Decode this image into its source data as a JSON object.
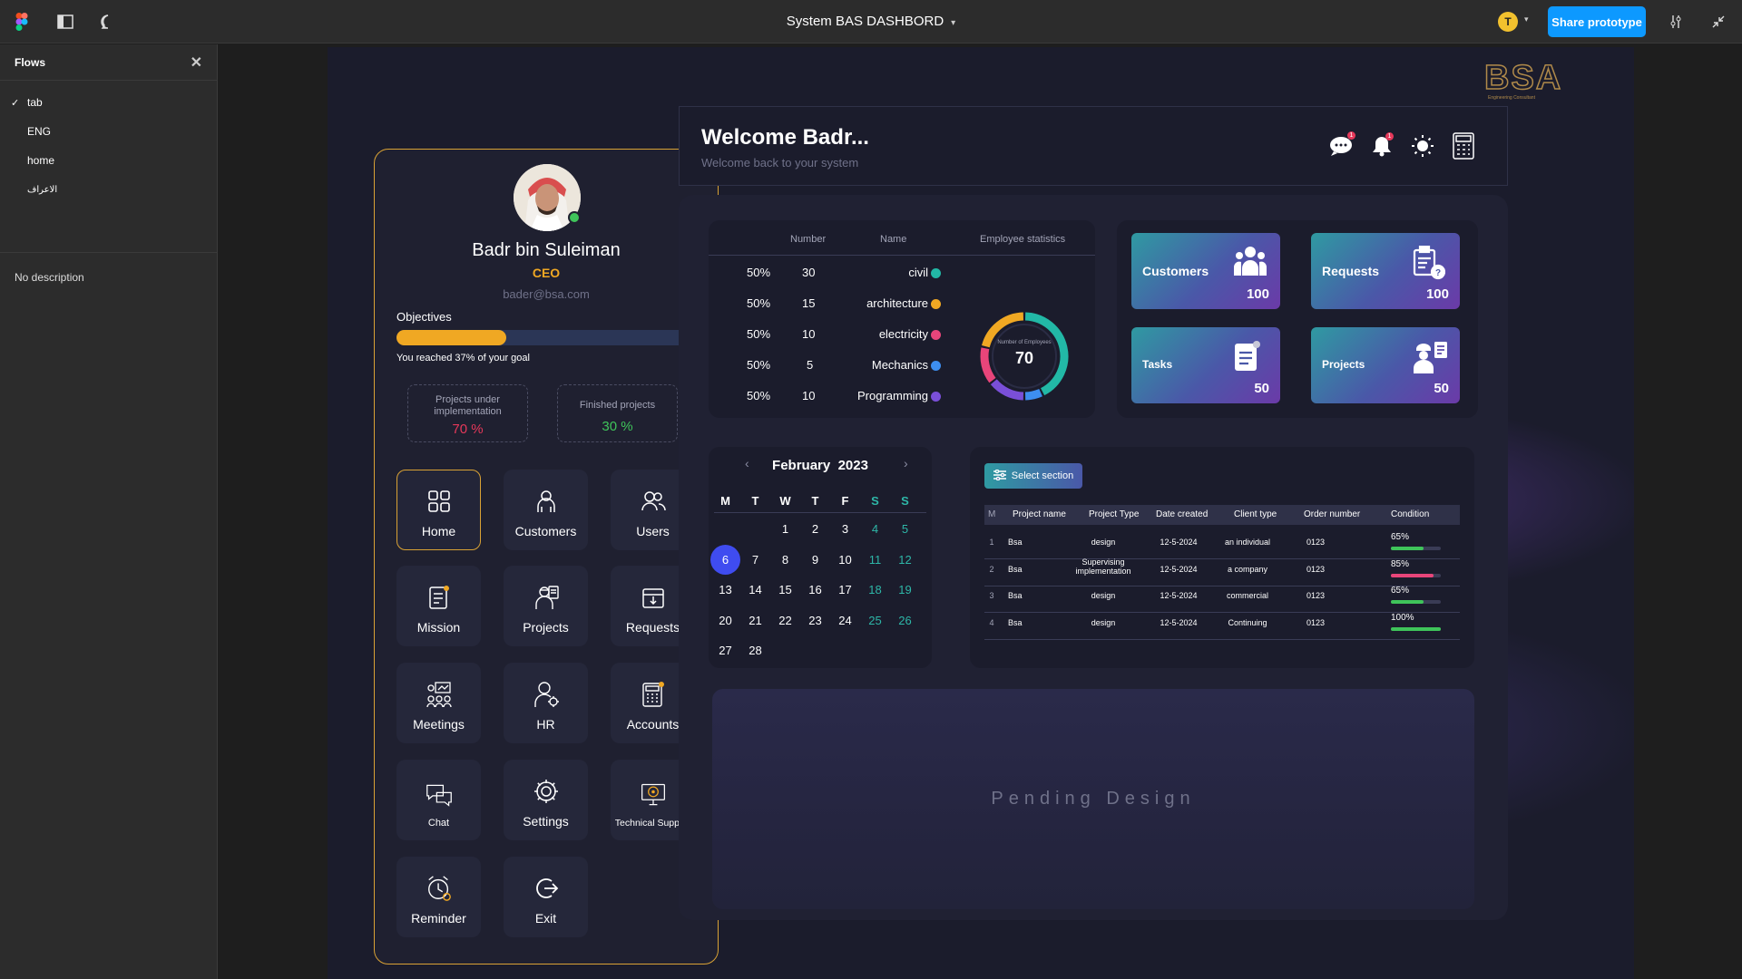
{
  "toolbar": {
    "title": "System BAS DASHBORD",
    "user_initial": "T",
    "share_label": "Share prototype"
  },
  "flows": {
    "header": "Flows",
    "items": [
      {
        "label": "tab",
        "checked": true
      },
      {
        "label": "ENG",
        "checked": false
      },
      {
        "label": "home",
        "checked": false
      },
      {
        "label": "الاعراف",
        "checked": false
      }
    ],
    "description": "No description"
  },
  "logo": {
    "text": "BSA",
    "tagline": "Engineering Consultant"
  },
  "profile": {
    "name": "Badr bin Suleiman",
    "role": "CEO",
    "email": "bader@bsa.com",
    "objectives_label": "Objectives",
    "objectives_progress": 0.37,
    "objectives_note": "You reached 37% of your goal",
    "stats": [
      {
        "label": "Projects under implementation",
        "value": "70 %",
        "color": "#e5385a"
      },
      {
        "label": "Finished projects",
        "value": "30 %",
        "color": "#3fc45a"
      }
    ]
  },
  "menu": [
    {
      "label": "Home",
      "icon": "grid-icon",
      "active": true
    },
    {
      "label": "Customers",
      "icon": "customers-icon",
      "active": false
    },
    {
      "label": "Users",
      "icon": "users-icon",
      "active": false
    },
    {
      "label": "Mission",
      "icon": "mission-icon",
      "active": false
    },
    {
      "label": "Projects",
      "icon": "projects-icon",
      "active": false
    },
    {
      "label": "Requests",
      "icon": "requests-icon",
      "active": false
    },
    {
      "label": "Meetings",
      "icon": "meetings-icon",
      "active": false
    },
    {
      "label": "HR",
      "icon": "hr-icon",
      "active": false
    },
    {
      "label": "Accounts",
      "icon": "calculator-icon",
      "active": false
    },
    {
      "label": "Chat",
      "icon": "chat-icon",
      "active": false
    },
    {
      "label": "Settings",
      "icon": "gear-icon",
      "active": false
    },
    {
      "label": "Technical Support",
      "icon": "support-icon",
      "active": false
    },
    {
      "label": "Reminder",
      "icon": "alarm-icon",
      "active": false
    },
    {
      "label": "Exit",
      "icon": "exit-icon",
      "active": false
    }
  ],
  "welcome": {
    "title": "Welcome Badr...",
    "subtitle": "Welcome back to your system",
    "chat_badge": "1",
    "bell_badge": "1"
  },
  "employees": {
    "headers": {
      "number": "Number",
      "name": "Name",
      "stats": "Employee statistics"
    },
    "rows": [
      {
        "pct": "50%",
        "number": "30",
        "name": "civil",
        "color": "#22b8a6"
      },
      {
        "pct": "50%",
        "number": "15",
        "name": "architecture",
        "color": "#f0a823"
      },
      {
        "pct": "50%",
        "number": "10",
        "name": "electricity",
        "color": "#e8457a"
      },
      {
        "pct": "50%",
        "number": "5",
        "name": "Mechanics",
        "color": "#3d8ef0"
      },
      {
        "pct": "50%",
        "number": "10",
        "name": "Programming",
        "color": "#7a4fd8"
      }
    ],
    "donut_label": "Number of Employees",
    "donut_value": "70"
  },
  "kpis": [
    {
      "label": "Customers",
      "value": "100",
      "icon": "customers-icon"
    },
    {
      "label": "Requests",
      "value": "100",
      "icon": "request-clipboard-icon"
    },
    {
      "label": "Tasks",
      "value": "50",
      "icon": "tasks-icon"
    },
    {
      "label": "Projects",
      "value": "50",
      "icon": "engineer-icon"
    }
  ],
  "calendar": {
    "month": "February",
    "year": "2023",
    "weekdays": [
      "M",
      "T",
      "W",
      "T",
      "F",
      "S",
      "S"
    ],
    "selected_day": "6",
    "weeks": [
      [
        "",
        "",
        "1",
        "2",
        "3",
        "4",
        "5"
      ],
      [
        "6",
        "7",
        "8",
        "9",
        "10",
        "11",
        "12"
      ],
      [
        "13",
        "14",
        "15",
        "16",
        "17",
        "18",
        "19"
      ],
      [
        "20",
        "21",
        "22",
        "23",
        "24",
        "25",
        "26"
      ],
      [
        "27",
        "28",
        "",
        "",
        "",
        "",
        ""
      ]
    ]
  },
  "projects_table": {
    "select_label": "Select section",
    "headers": [
      "M",
      "Project name",
      "Project Type",
      "Date created",
      "Client type",
      "Order number",
      "Condition"
    ],
    "rows": [
      {
        "m": "1",
        "name": "Bsa",
        "type": "design",
        "date": "12-5-2024",
        "client": "an individual",
        "order": "0123",
        "condition": "65%",
        "progress": 0.65,
        "color": "#3fc45a"
      },
      {
        "m": "2",
        "name": "Bsa",
        "type": "Supervising implementation",
        "date": "12-5-2024",
        "client": "a company",
        "order": "0123",
        "condition": "85%",
        "progress": 0.85,
        "color": "#e8457a"
      },
      {
        "m": "3",
        "name": "Bsa",
        "type": "design",
        "date": "12-5-2024",
        "client": "commercial",
        "order": "0123",
        "condition": "65%",
        "progress": 0.65,
        "color": "#3fc45a"
      },
      {
        "m": "4",
        "name": "Bsa",
        "type": "design",
        "date": "12-5-2024",
        "client": "Continuing",
        "order": "0123",
        "condition": "100%",
        "progress": 1.0,
        "color": "#3fc45a"
      }
    ]
  },
  "pending": {
    "text": "Pending Design"
  }
}
